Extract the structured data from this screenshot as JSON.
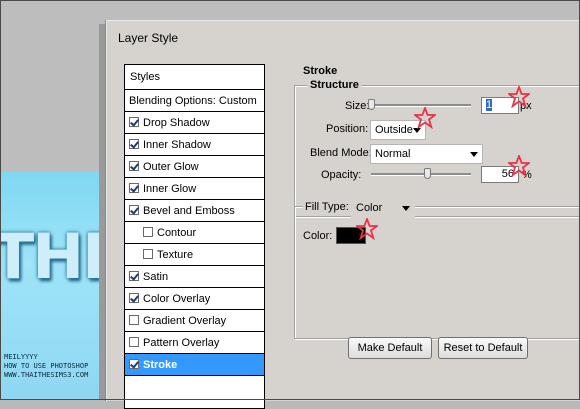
{
  "canvas": {
    "big_text": "THE",
    "credit_lines": [
      "MEILYYYY",
      "HOW TO USE PHOTOSHOP",
      "WWW.THAITHESIMS3.COM"
    ]
  },
  "dialog": {
    "title": "Layer Style",
    "styles_header": "Styles",
    "items": [
      {
        "label": "Blending Options: Custom",
        "checkbox": false
      },
      {
        "label": "Drop Shadow",
        "checkbox": true,
        "checked": true
      },
      {
        "label": "Inner Shadow",
        "checkbox": true,
        "checked": true
      },
      {
        "label": "Outer Glow",
        "checkbox": true,
        "checked": true
      },
      {
        "label": "Inner Glow",
        "checkbox": true,
        "checked": true
      },
      {
        "label": "Bevel and Emboss",
        "checkbox": true,
        "checked": true
      },
      {
        "label": "Contour",
        "checkbox": true,
        "checked": false,
        "indent": true
      },
      {
        "label": "Texture",
        "checkbox": true,
        "checked": false,
        "indent": true
      },
      {
        "label": "Satin",
        "checkbox": true,
        "checked": true
      },
      {
        "label": "Color Overlay",
        "checkbox": true,
        "checked": true
      },
      {
        "label": "Gradient Overlay",
        "checkbox": true,
        "checked": false
      },
      {
        "label": "Pattern Overlay",
        "checkbox": true,
        "checked": false
      },
      {
        "label": "Stroke",
        "checkbox": true,
        "checked": true,
        "selected": true
      }
    ],
    "stroke": {
      "title": "Stroke",
      "structure_title": "Structure",
      "size_label": "Size:",
      "size_value": "1",
      "size_unit": "px",
      "size_level": 0.0,
      "position_label": "Position:",
      "position_value": "Outside",
      "blend_label": "Blend Mode:",
      "blend_value": "Normal",
      "opacity_label": "Opacity:",
      "opacity_value": "56",
      "opacity_unit": "%",
      "opacity_level": 0.56,
      "fill_type_label": "Fill Type:",
      "fill_type_value": "Color",
      "color_label": "Color:",
      "color_value": "#000000"
    },
    "buttons": {
      "make_default": "Make Default",
      "reset_default": "Reset to Default"
    }
  },
  "colors": {
    "selection": "#3399ff",
    "annotation_star": "#e8334a"
  }
}
